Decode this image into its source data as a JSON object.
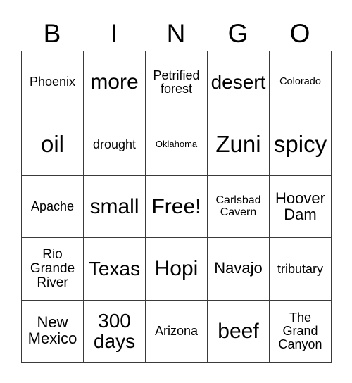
{
  "card": {
    "title": "BINGO",
    "header_letters": [
      "B",
      "I",
      "N",
      "G",
      "O"
    ],
    "columns": 5,
    "rows": 5,
    "free_space_label": "Free!",
    "border_color": "#3a3a3a",
    "text_color": "#000000",
    "background_color": "#ffffff",
    "grid": [
      [
        {
          "text": "Phoenix",
          "size": "fs-ml"
        },
        {
          "text": "more",
          "size": "fs-3xl"
        },
        {
          "text": "Petrified\nforest",
          "size": "fs-ml"
        },
        {
          "text": "desert",
          "size": "fs-2xl"
        },
        {
          "text": "Colorado",
          "size": "fs-sm"
        }
      ],
      [
        {
          "text": "oil",
          "size": "fs-4xl"
        },
        {
          "text": "drought",
          "size": "fs-ml"
        },
        {
          "text": "Oklahoma",
          "size": "fs-xs"
        },
        {
          "text": "Zuni",
          "size": "fs-4xl"
        },
        {
          "text": "spicy",
          "size": "fs-4xl"
        }
      ],
      [
        {
          "text": "Apache",
          "size": "fs-ml"
        },
        {
          "text": "small",
          "size": "fs-3xl"
        },
        {
          "text": "Free!",
          "size": "fs-3xl"
        },
        {
          "text": "Carlsbad\nCavern",
          "size": "fs-md"
        },
        {
          "text": "Hoover\nDam",
          "size": "fs-xl"
        }
      ],
      [
        {
          "text": "Rio\nGrande\nRiver",
          "size": "fs-lg"
        },
        {
          "text": "Texas",
          "size": "fs-2xl"
        },
        {
          "text": "Hopi",
          "size": "fs-3xl"
        },
        {
          "text": "Navajo",
          "size": "fs-xl"
        },
        {
          "text": "tributary",
          "size": "fs-ml"
        }
      ],
      [
        {
          "text": "New\nMexico",
          "size": "fs-xl"
        },
        {
          "text": "300\ndays",
          "size": "fs-2xl"
        },
        {
          "text": "Arizona",
          "size": "fs-ml"
        },
        {
          "text": "beef",
          "size": "fs-3xl"
        },
        {
          "text": "The\nGrand\nCanyon",
          "size": "fs-ml"
        }
      ]
    ]
  }
}
